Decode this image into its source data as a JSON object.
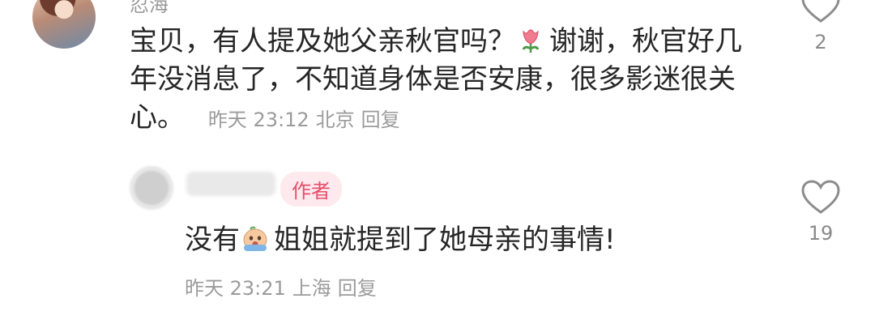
{
  "comment": {
    "username": "忍海",
    "text_part1": "宝贝，有人提及她父亲秋官吗？",
    "emoji": "tulip",
    "text_part2": "谢谢，秋官好几年没消息了，不知道身体是否安康，很多影迷很关心。",
    "time": "昨天 23:12",
    "location": "北京",
    "reply_label": "回复",
    "like_count": "2"
  },
  "reply": {
    "badge": "作者",
    "text_part1": "没有",
    "emoji": "crying-face",
    "text_part2": "姐姐就提到了她母亲的事情!",
    "time": "昨天 23:21",
    "location": "上海",
    "reply_label": "回复",
    "like_count": "19"
  },
  "colors": {
    "text": "#262626",
    "meta": "#9b9b9b",
    "badge_bg": "#fde9ee",
    "badge_text": "#e94d6a"
  }
}
